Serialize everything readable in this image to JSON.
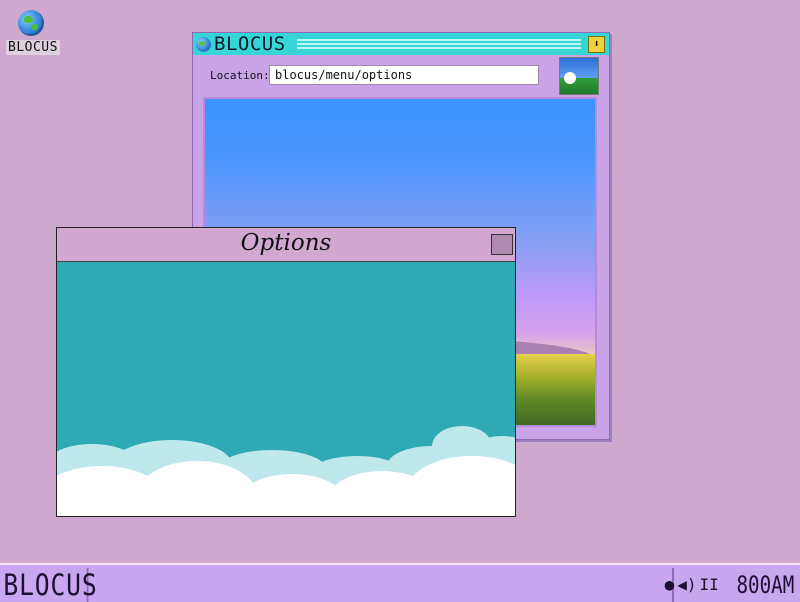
{
  "desktop": {
    "icon_label": "BLOCUS"
  },
  "browser": {
    "title": "BLOCUS",
    "minimize_symbol": "⬇",
    "location_label": "Location:",
    "location_value": "blocus/menu/options"
  },
  "options_window": {
    "title": "Options"
  },
  "taskbar": {
    "start_label": "BLOCUS",
    "tray_icons": [
      "balloon-icon",
      "speaker-icon",
      "pause-icon"
    ],
    "tray_symbols": [
      "●",
      "◀)",
      "II"
    ],
    "clock": "800AM"
  },
  "colors": {
    "desktop_bg": "#cfa8cf",
    "browser_title_bg": "#36d6d6",
    "options_bg": "#2faab5",
    "options_title_bg": "#d2a8d3",
    "taskbar_bg": "#c9a6f0"
  }
}
